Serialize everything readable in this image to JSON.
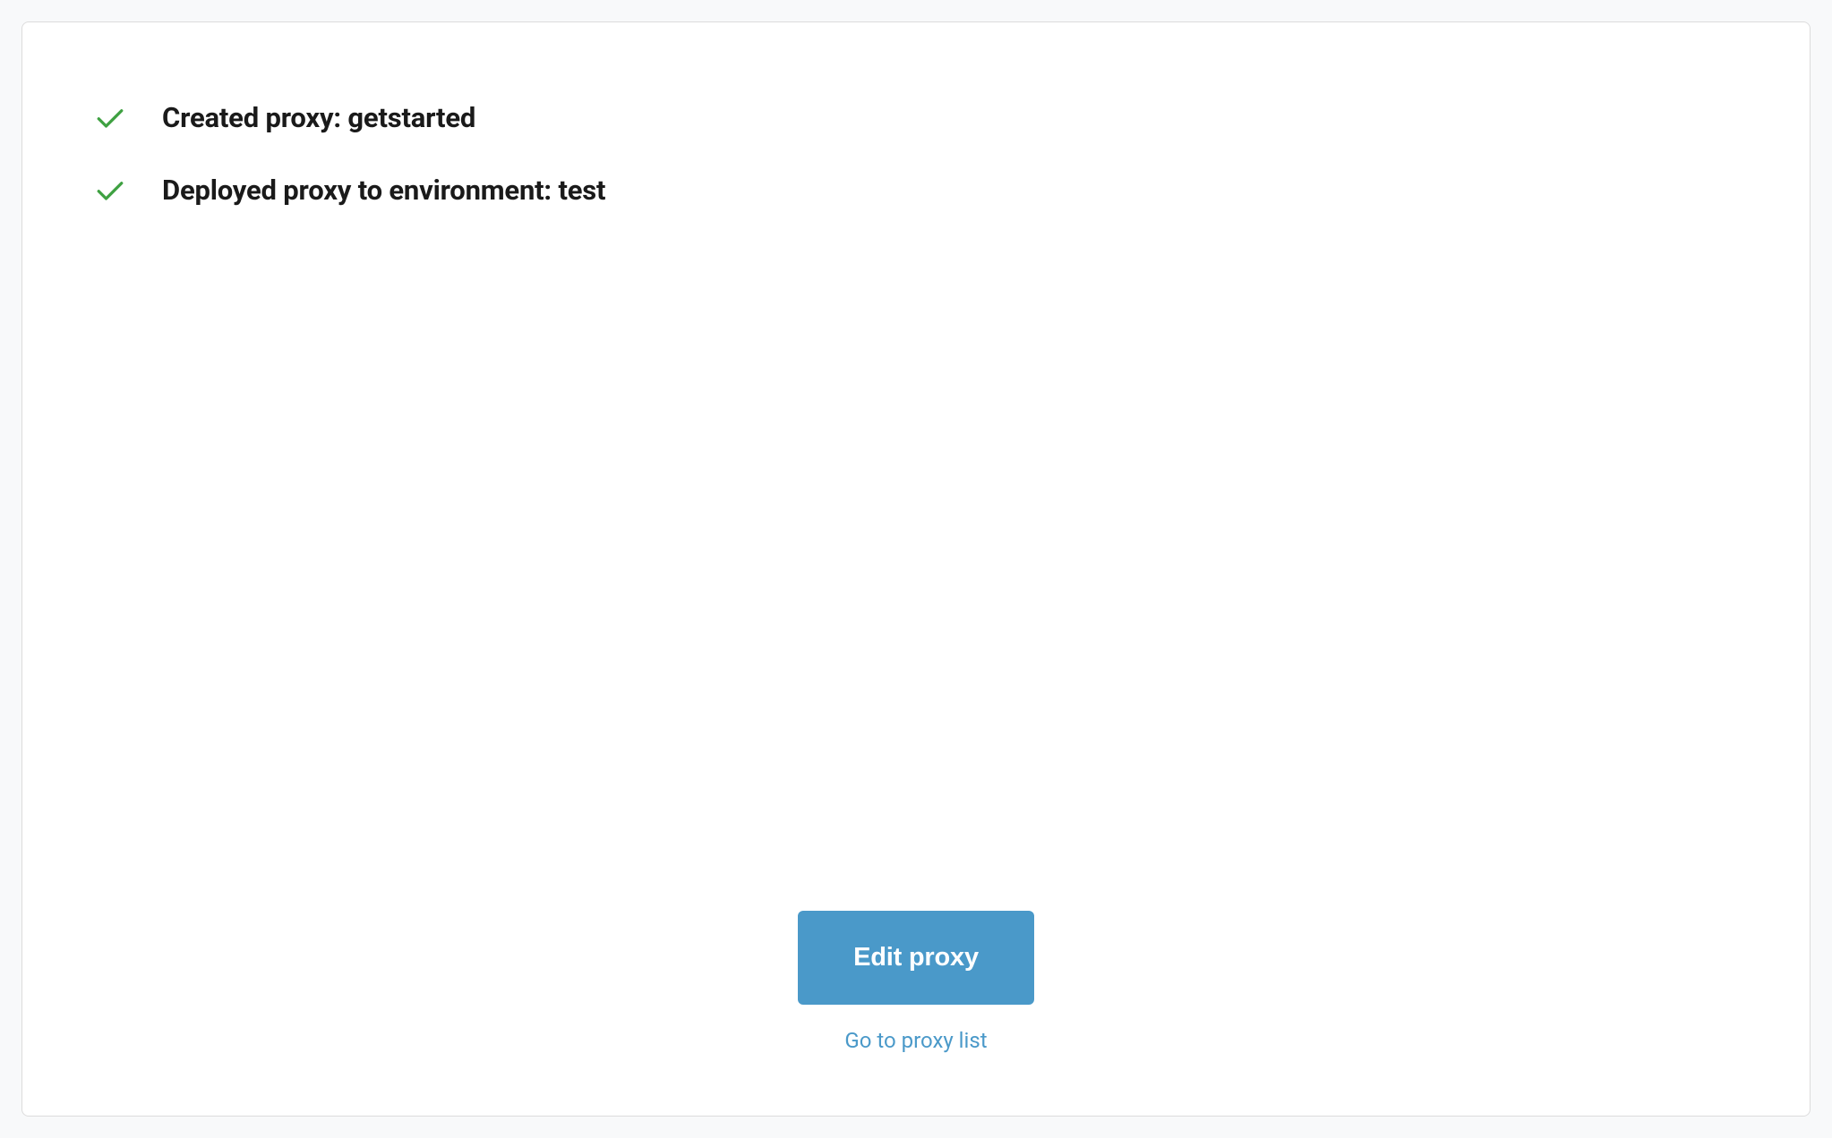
{
  "status": [
    {
      "message": "Created proxy: getstarted"
    },
    {
      "message": "Deployed proxy to environment: test"
    }
  ],
  "actions": {
    "primary_label": "Edit proxy",
    "secondary_label": "Go to proxy list"
  }
}
